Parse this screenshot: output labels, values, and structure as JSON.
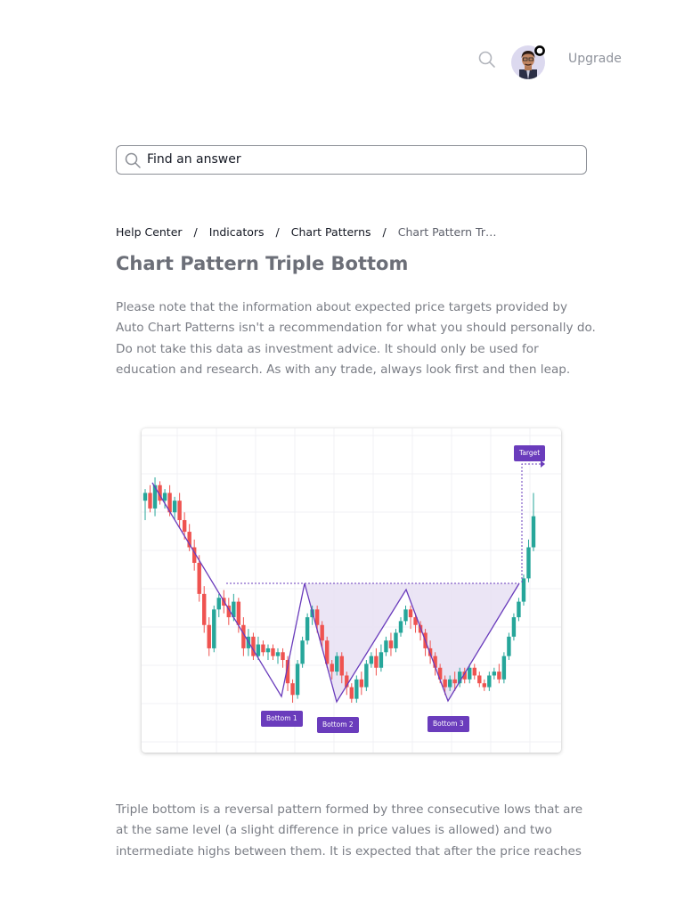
{
  "header": {
    "search_icon": "search-icon",
    "avatar": "user-avatar",
    "upgrade_label": "Upgrade"
  },
  "search": {
    "placeholder": "Find an answer"
  },
  "breadcrumb": {
    "items": [
      "Help Center",
      "Indicators",
      "Chart Patterns"
    ],
    "current": "Chart Pattern Tr…"
  },
  "article": {
    "title": "Chart Pattern Triple Bottom",
    "paragraph1": "Please note that the information about expected price targets provided by Auto Chart Patterns isn't a recommendation for what you should personally do. Do not take this data as investment advice. It should only be used for education and research. As with any trade, always look first and then leap.",
    "paragraph2": "Triple bottom is a reversal pattern formed by three consecutive lows that are at the same level (a slight difference in price values is allowed) and two intermediate highs between them. It is expected that after the price reaches"
  },
  "figure": {
    "labels": {
      "target": "Target",
      "bottom1": "Bottom 1",
      "bottom2": "Bottom 2",
      "bottom3": "Bottom 3"
    },
    "colors": {
      "up": "#26a69a",
      "down": "#ef5350",
      "pattern": "#6a3cbc",
      "fill": "#e7e0f3"
    },
    "candles": [
      [
        60,
        62,
        55,
        63
      ],
      [
        62,
        58,
        57,
        64
      ],
      [
        58,
        64,
        56,
        66
      ],
      [
        64,
        60,
        59,
        65
      ],
      [
        60,
        62,
        58,
        63
      ],
      [
        62,
        57,
        56,
        64
      ],
      [
        57,
        60,
        55,
        61
      ],
      [
        60,
        55,
        53,
        62
      ],
      [
        55,
        52,
        50,
        57
      ],
      [
        52,
        48,
        47,
        54
      ],
      [
        48,
        44,
        42,
        50
      ],
      [
        44,
        36,
        34,
        46
      ],
      [
        36,
        28,
        26,
        38
      ],
      [
        28,
        22,
        20,
        30
      ],
      [
        22,
        32,
        21,
        33
      ],
      [
        32,
        35,
        30,
        36
      ],
      [
        35,
        33,
        31,
        37
      ],
      [
        33,
        30,
        28,
        35
      ],
      [
        30,
        34,
        29,
        36
      ],
      [
        34,
        28,
        26,
        35
      ],
      [
        28,
        22,
        20,
        30
      ],
      [
        22,
        25,
        20,
        27
      ],
      [
        25,
        20,
        19,
        26
      ],
      [
        20,
        23,
        19,
        25
      ],
      [
        23,
        21,
        20,
        24
      ],
      [
        21,
        22,
        19,
        23
      ],
      [
        22,
        20,
        19,
        23
      ],
      [
        20,
        21,
        18,
        22
      ],
      [
        21,
        19,
        17,
        22
      ],
      [
        19,
        13,
        11,
        20
      ],
      [
        13,
        10,
        8,
        14
      ],
      [
        10,
        18,
        9,
        19
      ],
      [
        18,
        24,
        17,
        25
      ],
      [
        24,
        30,
        23,
        31
      ],
      [
        30,
        32,
        28,
        33
      ],
      [
        32,
        28,
        26,
        33
      ],
      [
        28,
        24,
        22,
        29
      ],
      [
        24,
        18,
        17,
        25
      ],
      [
        18,
        16,
        14,
        19
      ],
      [
        16,
        20,
        15,
        21
      ],
      [
        20,
        15,
        13,
        21
      ],
      [
        15,
        12,
        10,
        16
      ],
      [
        12,
        9,
        8,
        13
      ],
      [
        9,
        14,
        8,
        15
      ],
      [
        14,
        12,
        10,
        16
      ],
      [
        12,
        18,
        11,
        19
      ],
      [
        18,
        20,
        17,
        21
      ],
      [
        20,
        17,
        15,
        22
      ],
      [
        17,
        21,
        16,
        23
      ],
      [
        21,
        24,
        20,
        25
      ],
      [
        24,
        22,
        20,
        26
      ],
      [
        22,
        26,
        21,
        27
      ],
      [
        26,
        29,
        25,
        30
      ],
      [
        29,
        32,
        28,
        33
      ],
      [
        32,
        30,
        27,
        33
      ],
      [
        30,
        28,
        26,
        31
      ],
      [
        28,
        26,
        24,
        29
      ],
      [
        26,
        22,
        20,
        27
      ],
      [
        22,
        20,
        18,
        24
      ],
      [
        20,
        17,
        15,
        21
      ],
      [
        17,
        14,
        13,
        18
      ],
      [
        14,
        12,
        10,
        15
      ],
      [
        12,
        14,
        11,
        15
      ],
      [
        14,
        13,
        11,
        16
      ],
      [
        13,
        16,
        12,
        17
      ],
      [
        16,
        14,
        13,
        17
      ],
      [
        14,
        17,
        13,
        18
      ],
      [
        17,
        15,
        14,
        18
      ],
      [
        15,
        13,
        12,
        16
      ],
      [
        13,
        12,
        11,
        14
      ],
      [
        12,
        15,
        11,
        16
      ],
      [
        15,
        16,
        14,
        17
      ],
      [
        16,
        14,
        13,
        18
      ],
      [
        14,
        20,
        13,
        21
      ],
      [
        20,
        25,
        19,
        26
      ],
      [
        25,
        30,
        24,
        31
      ],
      [
        30,
        34,
        29,
        35
      ],
      [
        34,
        40,
        33,
        41
      ],
      [
        40,
        48,
        39,
        50
      ],
      [
        48,
        56,
        47,
        62
      ]
    ]
  }
}
